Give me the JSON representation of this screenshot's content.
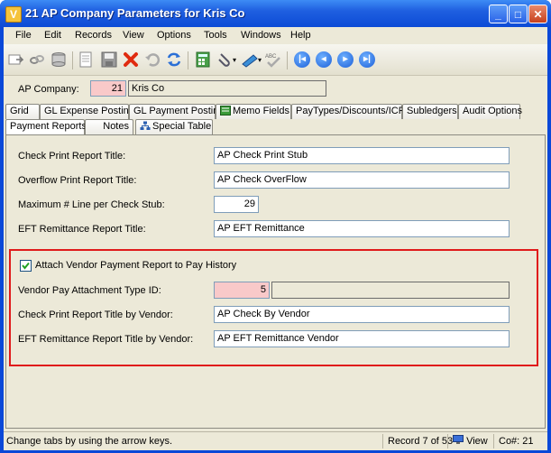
{
  "window": {
    "title": "21 AP Company Parameters for Kris Co",
    "app_icon_letter": "V"
  },
  "menu": {
    "items": [
      "File",
      "Edit",
      "Records",
      "View",
      "Options",
      "Tools",
      "Windows",
      "Help"
    ]
  },
  "toolbar": {
    "icons": [
      "new-record-icon",
      "link-icon",
      "database-icon",
      "page-icon",
      "save-icon",
      "delete-icon",
      "undo-icon",
      "refresh-icon",
      "calculator-icon",
      "attach-icon",
      "report-icon",
      "spellcheck-icon",
      "first-record-icon",
      "previous-record-icon",
      "next-record-icon",
      "last-record-icon"
    ],
    "spell_label": "ABC"
  },
  "header": {
    "ap_company_label": "AP Company:",
    "ap_company_value": "21",
    "company_name": "Kris Co"
  },
  "tabs": {
    "row1": [
      "Grid",
      "GL Expense Posting",
      "GL Payment Posting",
      "Memo Fields",
      "PayTypes/Discounts/ICR",
      "Subledgers",
      "Audit Options"
    ],
    "row2": [
      "Payment Reports",
      "Notes",
      "Special Table"
    ],
    "active": "Payment Reports"
  },
  "form": {
    "check_print_label": "Check Print Report Title:",
    "check_print_value": "AP Check Print Stub",
    "overflow_label": "Overflow Print Report Title:",
    "overflow_value": "AP Check OverFlow",
    "max_lines_label": "Maximum # Line per Check Stub:",
    "max_lines_value": "29",
    "eft_label": "EFT Remittance Report Title:",
    "eft_value": "AP EFT Remittance"
  },
  "vendor_section": {
    "attach_label": "Attach Vendor Payment Report to Pay History",
    "attach_checked": true,
    "type_id_label": "Vendor Pay Attachment Type ID:",
    "type_id_value": "5",
    "type_id_desc": "",
    "check_by_vendor_label": "Check Print Report Title by Vendor:",
    "check_by_vendor_value": "AP Check By Vendor",
    "eft_by_vendor_label": "EFT Remittance Report Title by Vendor:",
    "eft_by_vendor_value": "AP EFT Remittance Vendor"
  },
  "status": {
    "hint": "Change tabs by using the arrow keys.",
    "record": "Record 7 of 53",
    "mode": "View",
    "company": "Co#: 21"
  },
  "colors": {
    "title_bar": "#0d4bd6",
    "highlight_box": "#e01b1b",
    "required_field": "#f9c9c9",
    "face": "#ece9d8"
  }
}
